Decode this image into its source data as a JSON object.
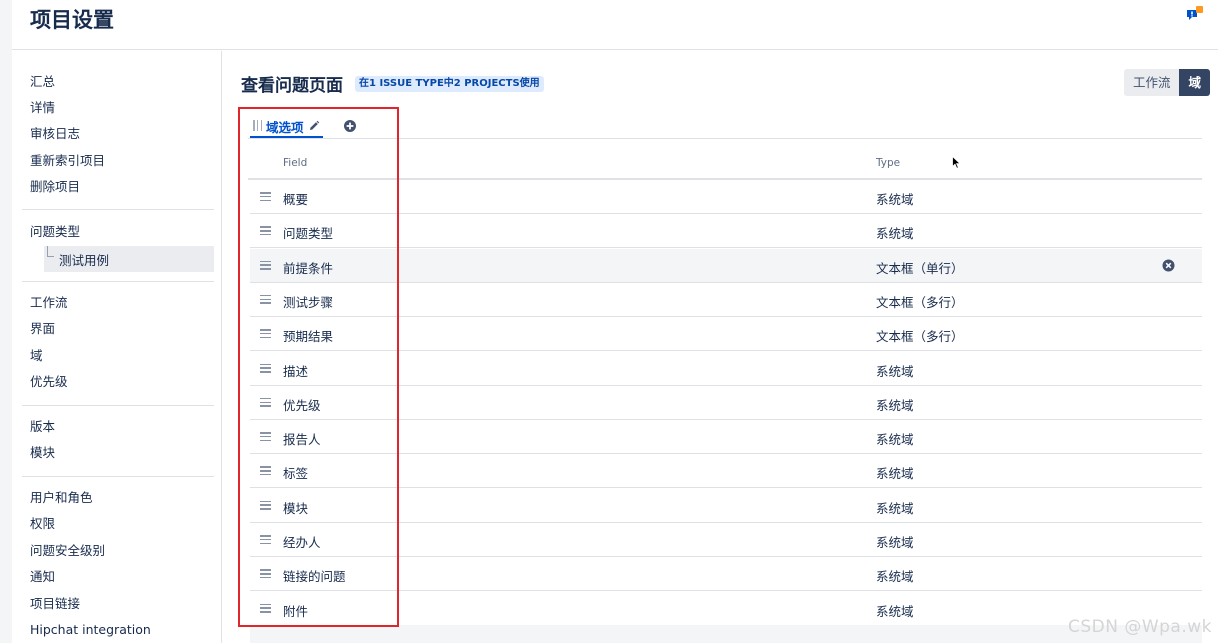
{
  "header": {
    "title": "项目设置",
    "feedback_icon": "feedback-icon"
  },
  "sidebar": {
    "groups": [
      {
        "items": [
          "汇总",
          "详情",
          "审核日志",
          "重新索引项目",
          "删除项目"
        ]
      },
      {
        "items": [
          "问题类型"
        ],
        "sub_item": "测试用例"
      },
      {
        "items": [
          "工作流",
          "界面",
          "域",
          "优先级"
        ]
      },
      {
        "items": [
          "版本",
          "模块"
        ]
      },
      {
        "items": [
          "用户和角色",
          "权限",
          "问题安全级别",
          "通知",
          "项目链接",
          "Hipchat integration"
        ]
      }
    ]
  },
  "main": {
    "title": "查看问题页面",
    "usage_badge": "在1 ISSUE TYPE中2 PROJECTS使用",
    "toggle": {
      "workflow_label": "工作流",
      "field_label": "域",
      "active": "域"
    },
    "tab": {
      "label": "域选项"
    },
    "table": {
      "columns": {
        "field": "Field",
        "type": "Type"
      },
      "rows": [
        {
          "field": "概要",
          "type": "系统域"
        },
        {
          "field": "问题类型",
          "type": "系统域"
        },
        {
          "field": "前提条件",
          "type": "文本框（单行）"
        },
        {
          "field": "测试步骤",
          "type": "文本框（多行）"
        },
        {
          "field": "预期结果",
          "type": "文本框（多行）"
        },
        {
          "field": "描述",
          "type": "系统域"
        },
        {
          "field": "优先级",
          "type": "系统域"
        },
        {
          "field": "报告人",
          "type": "系统域"
        },
        {
          "field": "标签",
          "type": "系统域"
        },
        {
          "field": "模块",
          "type": "系统域"
        },
        {
          "field": "经办人",
          "type": "系统域"
        },
        {
          "field": "链接的问题",
          "type": "系统域"
        },
        {
          "field": "附件",
          "type": "系统域"
        }
      ]
    }
  },
  "colors": {
    "accent": "#0052cc",
    "highlight_box": "#e0262b",
    "toggle_active": "#344563"
  },
  "watermark": "CSDN @Wpa.wk"
}
